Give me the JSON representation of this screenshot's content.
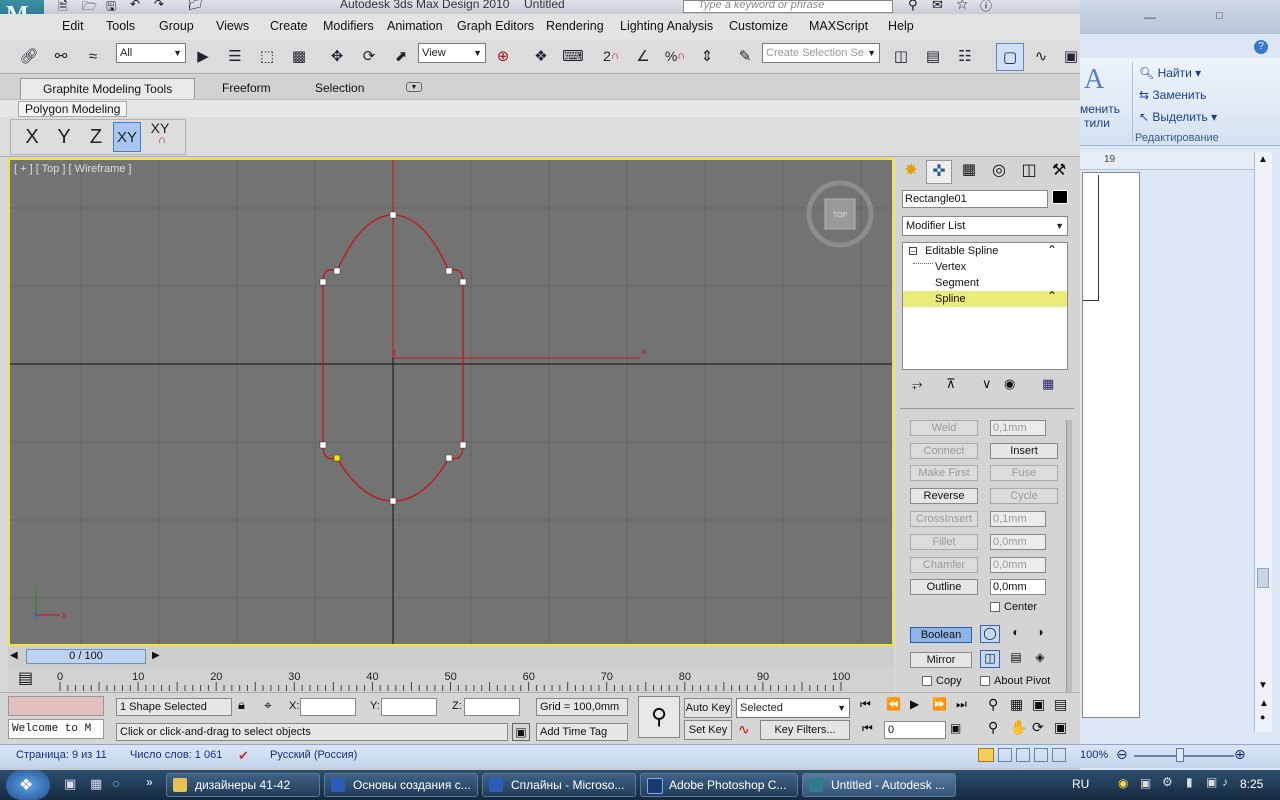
{
  "word_window": {
    "ribbon_find": "Найти",
    "ribbon_replace": "Заменить",
    "ribbon_select": "Выделить",
    "ribbon_group": "Редактирование",
    "ribbon_styles1": "менить",
    "ribbon_styles2": "тили",
    "ruler_mark": "19",
    "status_page": "Страница: 9 из 11",
    "status_words": "Число слов: 1 061",
    "status_lang": "Русский (Россия)",
    "zoom": "100%"
  },
  "max_window": {
    "title": "Autodesk 3ds Max Design 2010",
    "doc_title": "Untitled",
    "search_placeholder": "Type a keyword or phrase",
    "menu": [
      "Edit",
      "Tools",
      "Group",
      "Views",
      "Create",
      "Modifiers",
      "Animation",
      "Graph Editors",
      "Rendering",
      "Lighting Analysis",
      "Customize",
      "MAXScript",
      "Help"
    ],
    "toolbar": {
      "selection_filter": "All",
      "ref_coord": "View",
      "named_selection_placeholder": "Create Selection Se"
    },
    "ribbon_tabs": [
      "Graphite Modeling Tools",
      "Freeform",
      "Selection"
    ],
    "ribbon_panel": "Polygon Modeling",
    "axis_buttons": [
      "X",
      "Y",
      "Z",
      "XY",
      "XY"
    ],
    "viewport": {
      "label": "[ + ] [ Top ] [ Wireframe ]",
      "viewcube_label": "TOP",
      "axis_y": "y",
      "axis_x": "x",
      "axis_z": "z",
      "gizmo_x": "x",
      "gizmo_z": "z"
    },
    "command_panel": {
      "object_name": "Rectangle01",
      "modifier_list": "Modifier List",
      "stack": [
        {
          "label": "Editable Spline",
          "level": 0,
          "selected": false
        },
        {
          "label": "Vertex",
          "level": 1,
          "selected": false
        },
        {
          "label": "Segment",
          "level": 1,
          "selected": false
        },
        {
          "label": "Spline",
          "level": 1,
          "selected": true
        }
      ],
      "weld": "Weld",
      "weld_val": "0,1mm",
      "connect": "Connect",
      "insert": "Insert",
      "make_first": "Make First",
      "fuse": "Fuse",
      "reverse": "Reverse",
      "cycle": "Cycle",
      "crossinsert": "CrossInsert",
      "crossinsert_val": "0,1mm",
      "fillet": "Fillet",
      "fillet_val": "0,0mm",
      "chamfer": "Chamfer",
      "chamfer_val": "0,0mm",
      "outline": "Outline",
      "outline_val": "0,0mm",
      "center": "Center",
      "boolean": "Boolean",
      "mirror": "Mirror",
      "copy": "Copy",
      "about_pivot": "About Pivot"
    },
    "time_slider": "0 / 100",
    "track_ticks": [
      "0",
      "10",
      "20",
      "30",
      "40",
      "50",
      "60",
      "70",
      "80",
      "90",
      "100"
    ],
    "status": {
      "selected": "1 Shape Selected",
      "prompt": "Click or click-and-drag to select objects",
      "listener": "Welcome to M",
      "x_label": "X:",
      "y_label": "Y:",
      "z_label": "Z:",
      "grid": "Grid = 100,0mm",
      "add_time_tag": "Add Time Tag",
      "auto_key": "Auto Key",
      "set_key": "Set Key",
      "key_mode": "Selected",
      "key_filters": "Key Filters...",
      "frame": "0"
    }
  },
  "taskbar": {
    "items": [
      "дизайнеры 41-42",
      "Основы создания с...",
      "Сплайны - Microso...",
      "Adobe Photoshop C...",
      "Untitled - Autodesk ..."
    ],
    "lang": "RU",
    "clock": "8:25"
  }
}
